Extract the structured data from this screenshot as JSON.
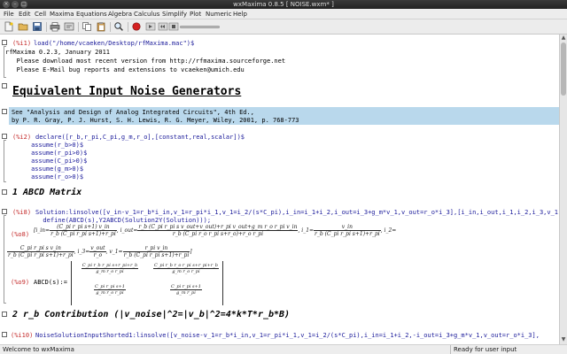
{
  "window": {
    "title": "wxMaxima 0.8.5 [ NOISE.wxm* ]"
  },
  "menu": [
    "File",
    "Edit",
    "Cell",
    "Maxima",
    "Equations",
    "Algebra",
    "Calculus",
    "Simplify",
    "Plot",
    "Numeric",
    "Help"
  ],
  "toolbar": {
    "icons": [
      "new-icon",
      "open-icon",
      "save-icon",
      "print-icon",
      "config-icon",
      "copy-icon",
      "paste-icon",
      "search-icon",
      "interrupt-icon",
      "play-icon",
      "rewind-icon",
      "stop-icon",
      "slider"
    ]
  },
  "cells": {
    "c1": {
      "label": "(%i1)",
      "input": "load(\"/home/vcaeken/Desktop/rfMaxima.mac\")$",
      "out1": "rfMaxima 0.2.3, January 2011",
      "out2": "   Please download most recent version from http://rfmaxima.sourceforge.net",
      "out3": "   Please E-Mail bug reports and extensions to vcaeken@umich.edu"
    },
    "title": "Equivalent Input Noise Generators",
    "text": {
      "line1": "See \"Analysis and Design of Analog Integrated Circuits\", 4th Ed.,",
      "line2": "by P. R. Gray, P. J. Hurst, S. H. Lewis, R. G. Meyer, Wiley, 2001, p. 768-773"
    },
    "c2": {
      "label": "(%i2)",
      "lines": [
        "declare([r_b,r_pi,C_pi,g_m,r_o],[constant,real,scalar])$",
        "     assume(r_b>0)$",
        "     assume(r_pi>0)$",
        "     assume(C_pi>0)$",
        "     assume(g_m>0)$",
        "     assume(r_o>0)$"
      ]
    },
    "sec1": "1 ABCD Matrix",
    "c8": {
      "label": "(%i8)",
      "line1": "Solution:linsolve([v_in-v_1=r_b*i_in,v_1=r_pi*i_1,v_1=i_2/(s*C_pi),i_in=i_1+i_2,i_out=i_3+g_m*v_1,v_out=r_o*i_3],[i_in,i_out,i_1,i_2,i_3,v_1]),",
      "line2": "  define(ABCD(s),Y2ABCD(Solution2Y(Solution)));"
    },
    "o8": {
      "label": "(%o8)",
      "t_i_in": "[i_in=",
      "f1_num": "(C_pi r_pi s+1) v_in",
      "f1_den": "r_b (C_pi r_pi s+1)+r_pi",
      "t_i_out": ", i_out=",
      "f2_num": "r_b (C_pi r_pi s v_out+v_out)+r_pi v_out+g_m r_o r_pi v_in",
      "f2_den": "r_b (C_pi r_o r_pi s+r_o)+r_o r_pi",
      "t_i1": ", i_1=",
      "f3_num": "v_in",
      "f3_den": "r_b (C_pi r_pi s+1)+r_pi",
      "t_i2": ", i_2=",
      "f4_num": "C_pi r_pi s v_in",
      "f4_den": "r_b (C_pi r_pi s+1)+r_pi",
      "t_i3": ", i_3=",
      "f5_num": "v_out",
      "f5_den": "r_o",
      "t_v1": ", v_1=",
      "f6_num": "r_pi v_in",
      "f6_den": "r_b (C_pi r_pi s+1)+r_pi",
      "t_end": "]"
    },
    "o9": {
      "label": "(%o9)",
      "lhs": "ABCD(s):=",
      "m11_num": "C_pi r_b r_pi s+r_pi+r_b",
      "m11_den": "g_m r_o r_pi",
      "m12_num": "C_pi r_b r_o r_pi s+r_pi+r_b",
      "m12_den": "g_m r_o r_pi",
      "m21_num": "C_pi r_pi s+1",
      "m21_den": "g_m r_o r_pi",
      "m22_num": "C_pi r_pi s+1",
      "m22_den": "g_m r_pi"
    },
    "sec2": "2 r_b Contribution (|v_noise|^2=|v_b|^2=4*k*T*r_b*B)",
    "c10": {
      "label": "(%i10)",
      "input": "NoiseSolutionInputShorted1:linsolve([v_noise-v_1=r_b*i_in,v_1=r_pi*i_1,v_1=i_2/(s*C_pi),i_in=i_1+i_2,-i_out=i_3+g_m*v_1,v_out=r_o*i_3],"
    }
  },
  "status": {
    "left": "Welcome to wxMaxima",
    "right": "Ready for user input"
  }
}
